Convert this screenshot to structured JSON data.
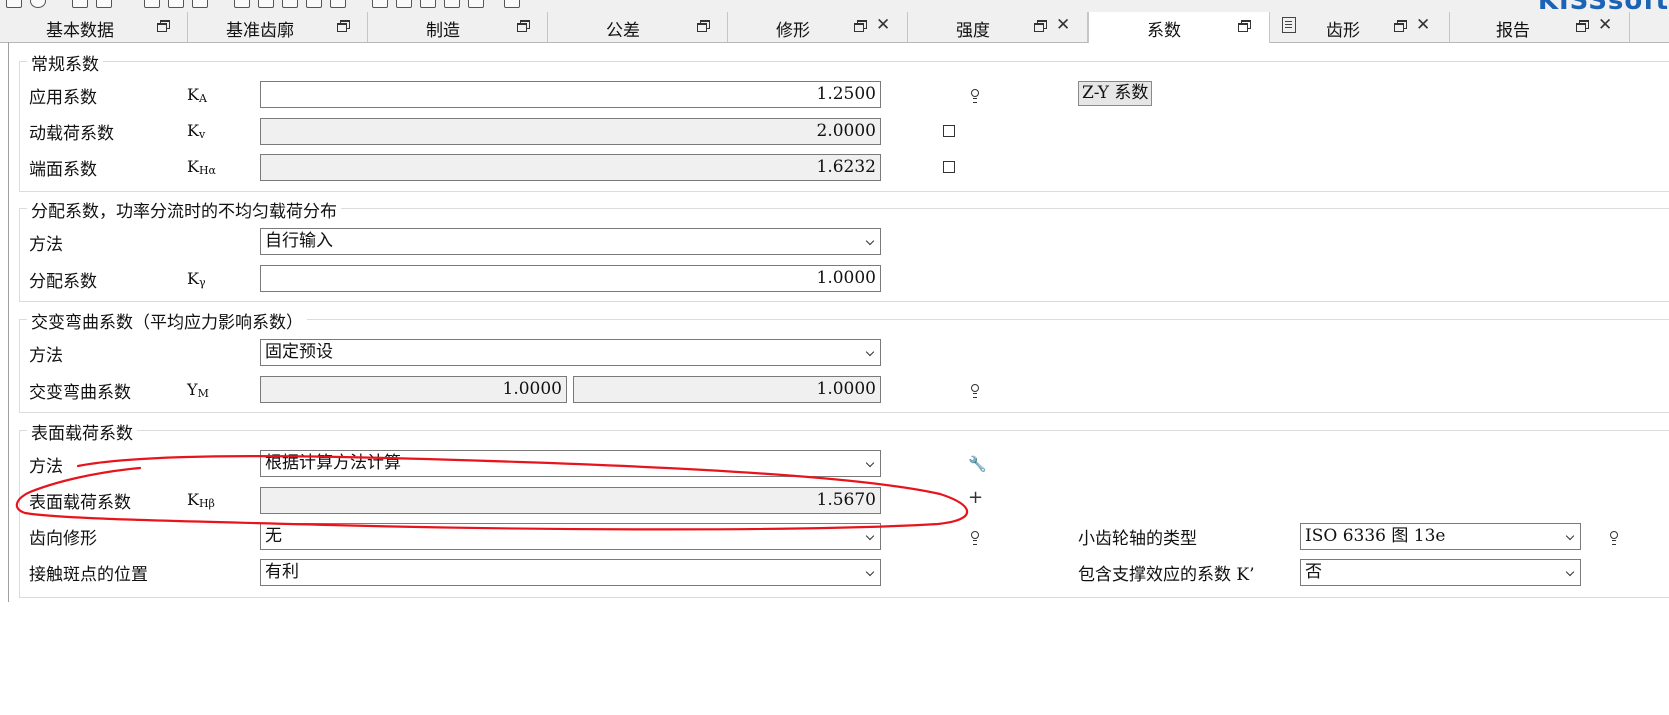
{
  "brand": "KISSsoft",
  "tabs": [
    {
      "label": "基本数据",
      "closable": false,
      "active": false
    },
    {
      "label": "基准齿廓",
      "closable": false,
      "active": false
    },
    {
      "label": "制造",
      "closable": false,
      "active": false
    },
    {
      "label": "公差",
      "closable": false,
      "active": false
    },
    {
      "label": "修形",
      "closable": true,
      "active": false
    },
    {
      "label": "强度",
      "closable": true,
      "active": false
    },
    {
      "label": "系数",
      "closable": false,
      "active": true
    },
    {
      "label": "齿形",
      "closable": true,
      "active": false
    },
    {
      "label": "报告",
      "closable": true,
      "active": false
    }
  ],
  "general": {
    "title": "常规系数",
    "application": {
      "label": "应用系数",
      "symbol": "K",
      "sub": "A",
      "value": "1.2500"
    },
    "dynamic": {
      "label": "动载荷系数",
      "symbol": "K",
      "sub": "v",
      "value": "2.0000"
    },
    "face": {
      "label": "端面系数",
      "symbol": "K",
      "sub": "Hα",
      "value": "1.6232"
    },
    "zy_button": "Z-Y 系数"
  },
  "distribution": {
    "title": "分配系数，功率分流时的不均匀载荷分布",
    "method_label": "方法",
    "method_value": "自行输入",
    "factor_label": "分配系数",
    "factor_symbol": "K",
    "factor_sub": "γ",
    "factor_value": "1.0000"
  },
  "bending": {
    "title": "交变弯曲系数（平均应力影响系数）",
    "method_label": "方法",
    "method_value": "固定预设",
    "factor_label": "交变弯曲系数",
    "factor_symbol": "Y",
    "factor_sub": "M",
    "value1": "1.0000",
    "value2": "1.0000"
  },
  "surface": {
    "title": "表面载荷系数",
    "method_label": "方法",
    "method_value": "根据计算方法计算",
    "factor_label": "表面载荷系数",
    "factor_symbol": "K",
    "factor_sub": "Hβ",
    "factor_value": "1.5670",
    "mod_label": "齿向修形",
    "mod_value": "无",
    "contact_label": "接触斑点的位置",
    "contact_value": "有利",
    "pinion_label": "小齿轮轴的类型",
    "pinion_value": "ISO 6336 图 13e",
    "support_label": "包含支撑效应的系数 K’",
    "support_value": "否"
  },
  "colors": {
    "annotation": "#e8141c",
    "brand": "#1b63b4",
    "field_readonly": "#f0f0f0"
  }
}
